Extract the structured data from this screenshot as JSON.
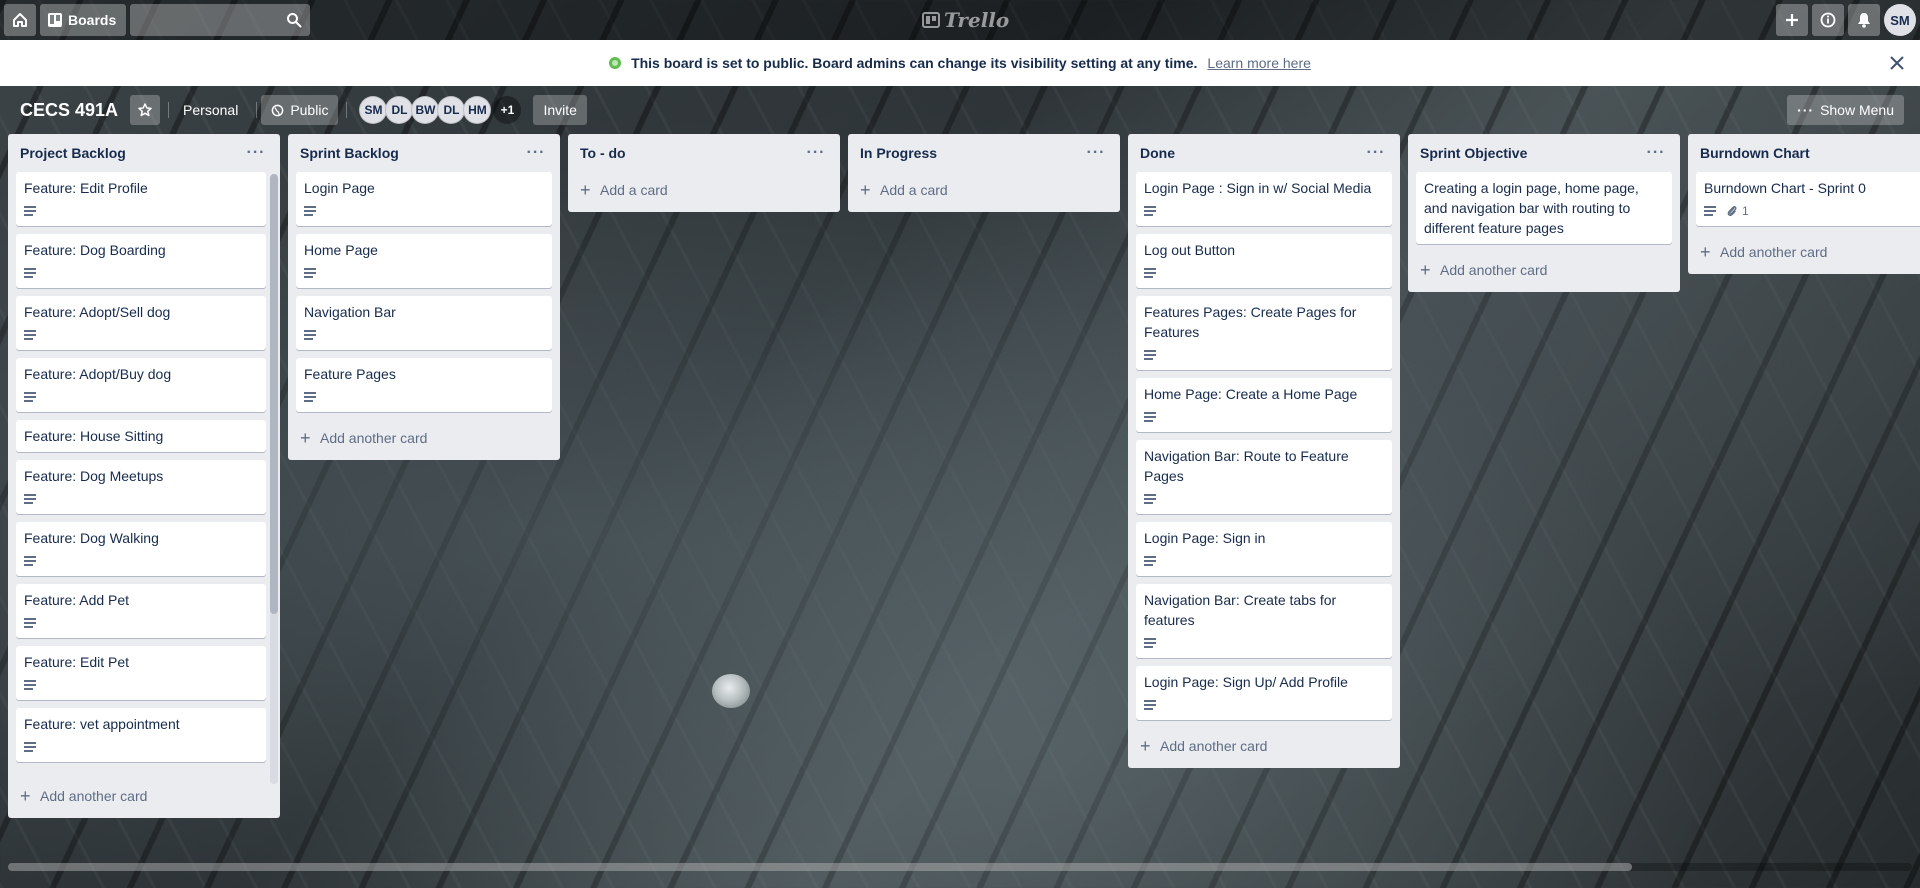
{
  "header": {
    "boards_label": "Boards",
    "logo_text": "Trello",
    "user_initials": "SM"
  },
  "notice": {
    "message": "This board is set to public. Board admins can change its visibility setting at any time.",
    "link_text": "Learn more here"
  },
  "board": {
    "title": "CECS 491A",
    "team": "Personal",
    "visibility": "Public",
    "members": [
      "SM",
      "DL",
      "BW",
      "DL",
      "HM"
    ],
    "more_members": "+1",
    "invite_label": "Invite",
    "show_menu_label": "Show Menu"
  },
  "lists": [
    {
      "title": "Project Backlog",
      "cards": [
        {
          "text": "Feature: Edit Profile",
          "desc": true
        },
        {
          "text": "Feature: Dog Boarding",
          "desc": true
        },
        {
          "text": "Feature: Adopt/Sell dog",
          "desc": true
        },
        {
          "text": "Feature: Adopt/Buy dog",
          "desc": true
        },
        {
          "text": "Feature: House Sitting",
          "desc": false
        },
        {
          "text": "Feature: Dog Meetups",
          "desc": true
        },
        {
          "text": "Feature: Dog Walking",
          "desc": true
        },
        {
          "text": "Feature: Add Pet",
          "desc": true
        },
        {
          "text": "Feature: Edit Pet",
          "desc": true
        },
        {
          "text": "Feature: vet appointment",
          "desc": true
        }
      ],
      "add_label": "Add another card"
    },
    {
      "title": "Sprint Backlog",
      "cards": [
        {
          "text": "Login Page",
          "desc": true
        },
        {
          "text": "Home Page",
          "desc": true
        },
        {
          "text": "Navigation Bar",
          "desc": true
        },
        {
          "text": "Feature Pages",
          "desc": true
        }
      ],
      "add_label": "Add another card"
    },
    {
      "title": "To - do",
      "cards": [],
      "add_label": "Add a card"
    },
    {
      "title": "In Progress",
      "cards": [],
      "add_label": "Add a card"
    },
    {
      "title": "Done",
      "cards": [
        {
          "text": "Login Page : Sign in w/ Social Media",
          "desc": true
        },
        {
          "text": "Log out Button",
          "desc": true
        },
        {
          "text": "Features Pages: Create Pages for Features",
          "desc": true
        },
        {
          "text": "Home Page: Create a Home Page",
          "desc": true
        },
        {
          "text": "Navigation Bar: Route to Feature Pages",
          "desc": true
        },
        {
          "text": "Login Page: Sign in",
          "desc": true
        },
        {
          "text": "Navigation Bar: Create tabs for features",
          "desc": true
        },
        {
          "text": "Login Page: Sign Up/ Add Profile",
          "desc": true
        }
      ],
      "add_label": "Add another card"
    },
    {
      "title": "Sprint Objective",
      "cards": [
        {
          "text": "Creating a login page, home page, and navigation bar with routing to different feature pages",
          "desc": false
        }
      ],
      "add_label": "Add another card"
    },
    {
      "title": "Burndown Chart",
      "cards": [
        {
          "text": "Burndown Chart - Sprint 0",
          "desc": true,
          "attachments": "1"
        }
      ],
      "add_label": "Add another card"
    }
  ],
  "colors": {
    "list_bg": "#ebecf0",
    "public_icon": "#61bd4f",
    "text": "#172b4d"
  }
}
